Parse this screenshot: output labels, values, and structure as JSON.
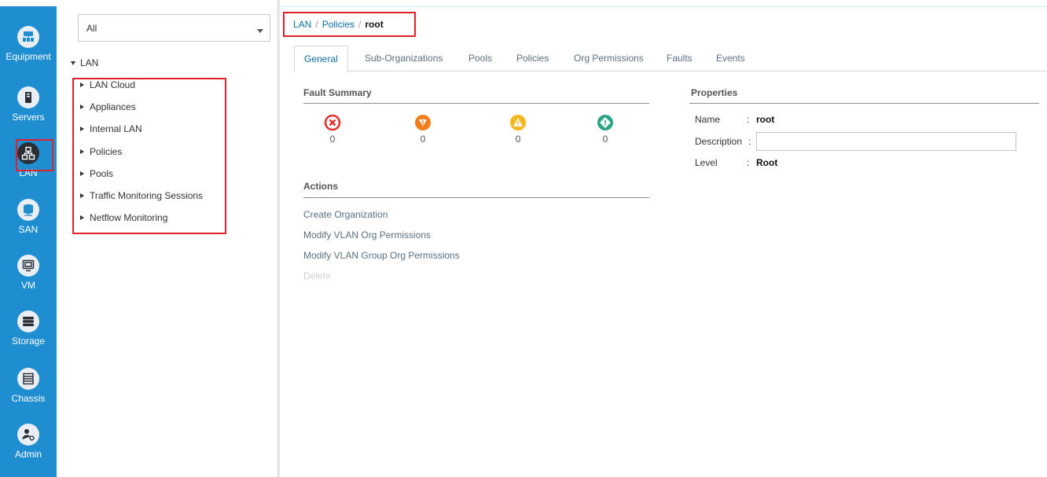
{
  "rail": {
    "items": [
      {
        "key": "equipment",
        "label": "Equipment",
        "icon": "equipment-icon"
      },
      {
        "key": "servers",
        "label": "Servers",
        "icon": "server-icon"
      },
      {
        "key": "lan",
        "label": "LAN",
        "icon": "lan-icon",
        "active": true
      },
      {
        "key": "san",
        "label": "SAN",
        "icon": "san-icon"
      },
      {
        "key": "vm",
        "label": "VM",
        "icon": "vm-icon"
      },
      {
        "key": "storage",
        "label": "Storage",
        "icon": "storage-icon"
      },
      {
        "key": "chassis",
        "label": "Chassis",
        "icon": "chassis-icon"
      },
      {
        "key": "admin",
        "label": "Admin",
        "icon": "admin-icon"
      }
    ]
  },
  "nav": {
    "filter_value": "All",
    "root_label": "LAN",
    "items": [
      "LAN Cloud",
      "Appliances",
      "Internal LAN",
      "Policies",
      "Pools",
      "Traffic Monitoring Sessions",
      "Netflow Monitoring"
    ]
  },
  "breadcrumb": {
    "part1": "LAN",
    "part2": "Policies",
    "current": "root",
    "separator": "/"
  },
  "tabs": [
    "General",
    "Sub-Organizations",
    "Pools",
    "Policies",
    "Org Permissions",
    "Faults",
    "Events"
  ],
  "fault_summary": {
    "title": "Fault Summary",
    "items": [
      {
        "severity": "critical",
        "icon": "critical-fault-icon",
        "count": "0",
        "color": "#e0302a"
      },
      {
        "severity": "major",
        "icon": "major-fault-icon",
        "count": "0",
        "color": "#f07d1e"
      },
      {
        "severity": "minor",
        "icon": "minor-fault-icon",
        "count": "0",
        "color": "#f5b81c"
      },
      {
        "severity": "warning",
        "icon": "warning-fault-icon",
        "count": "0",
        "color": "#2aa486"
      }
    ]
  },
  "actions": {
    "title": "Actions",
    "items": [
      {
        "label": "Create Organization",
        "enabled": true
      },
      {
        "label": "Modify VLAN Org Permissions",
        "enabled": true
      },
      {
        "label": "Modify VLAN Group Org Permissions",
        "enabled": true
      },
      {
        "label": "Delete",
        "enabled": false
      }
    ]
  },
  "properties": {
    "title": "Properties",
    "name_label": "Name",
    "name_value": "root",
    "description_label": "Description",
    "description_value": "",
    "level_label": "Level",
    "level_value": "Root",
    "colon": ":"
  },
  "colors": {
    "rail_bg": "#1f8ed1",
    "highlight": "#e0202a",
    "link": "#0b6fa8"
  }
}
